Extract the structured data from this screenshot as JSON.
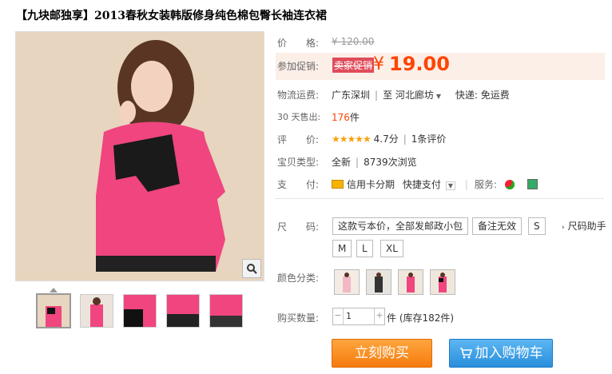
{
  "title": "【九块邮独享】2013春秋女装韩版修身纯色棉包臀长袖连衣裙",
  "price": {
    "label": "价　　格:",
    "original": "¥ 120.00"
  },
  "promo": {
    "label": "参加促销:",
    "badge": "卖家促销",
    "currency": "¥",
    "value": "19.00"
  },
  "shipping": {
    "label": "物流运费:",
    "from": "广东深圳",
    "to_prefix": "至",
    "to": "河北廊坊",
    "express": "快递: 免运费"
  },
  "sales": {
    "label": "30 天售出:",
    "count": "176",
    "unit": "件"
  },
  "rating": {
    "label": "评　　价:",
    "stars": "★★★★★",
    "score": "4.7分",
    "reviews": "1条评价"
  },
  "type": {
    "label": "宝贝类型:",
    "condition": "全新",
    "views": "8739次浏览"
  },
  "payment": {
    "label": "支　　付:",
    "credit": "信用卡分期",
    "quick": "快捷支付",
    "service_label": "服务:"
  },
  "size": {
    "label": "尺　　码:",
    "note1": "这款亏本价，全部发邮政小包",
    "note2": "备注无效",
    "options": [
      "S",
      "M",
      "L",
      "XL"
    ],
    "helper": "尺码助手"
  },
  "color": {
    "label": "颜色分类:"
  },
  "quantity": {
    "label": "购买数量:",
    "value": "1",
    "stock": "件 (库存182件)"
  },
  "buttons": {
    "buy": "立刻购买",
    "cart": "加入购物车"
  },
  "colors": {
    "accent": "#ff4400",
    "pink": "#f0457f",
    "buy": "#f57b0d",
    "cart": "#2a8fdc"
  }
}
